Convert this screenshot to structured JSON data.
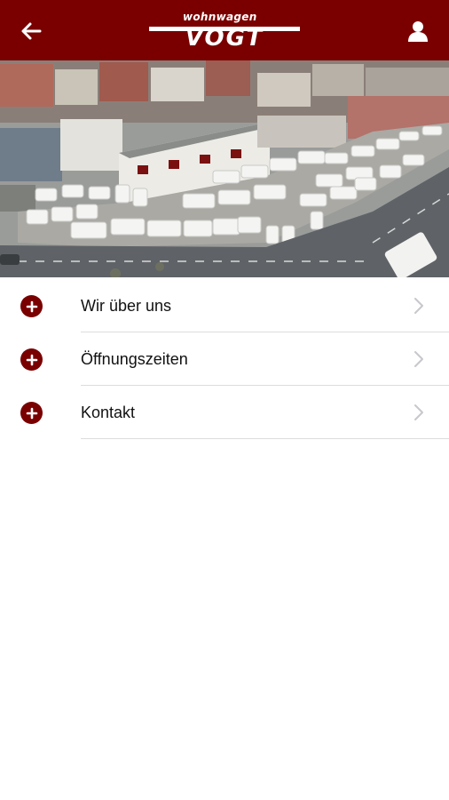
{
  "header": {
    "brand_small": "wohnwagen",
    "brand_large": "VOGT",
    "back_icon": "arrow-left-icon",
    "user_icon": "user-icon",
    "background": "#7a0000"
  },
  "hero": {
    "image": "aerial photo of caravan dealership lot with parked caravans"
  },
  "menu": {
    "items": [
      {
        "label": "Wir über uns",
        "icon": "plus-circle-icon"
      },
      {
        "label": "Öffnungszeiten",
        "icon": "plus-circle-icon"
      },
      {
        "label": "Kontakt",
        "icon": "plus-circle-icon"
      }
    ]
  }
}
